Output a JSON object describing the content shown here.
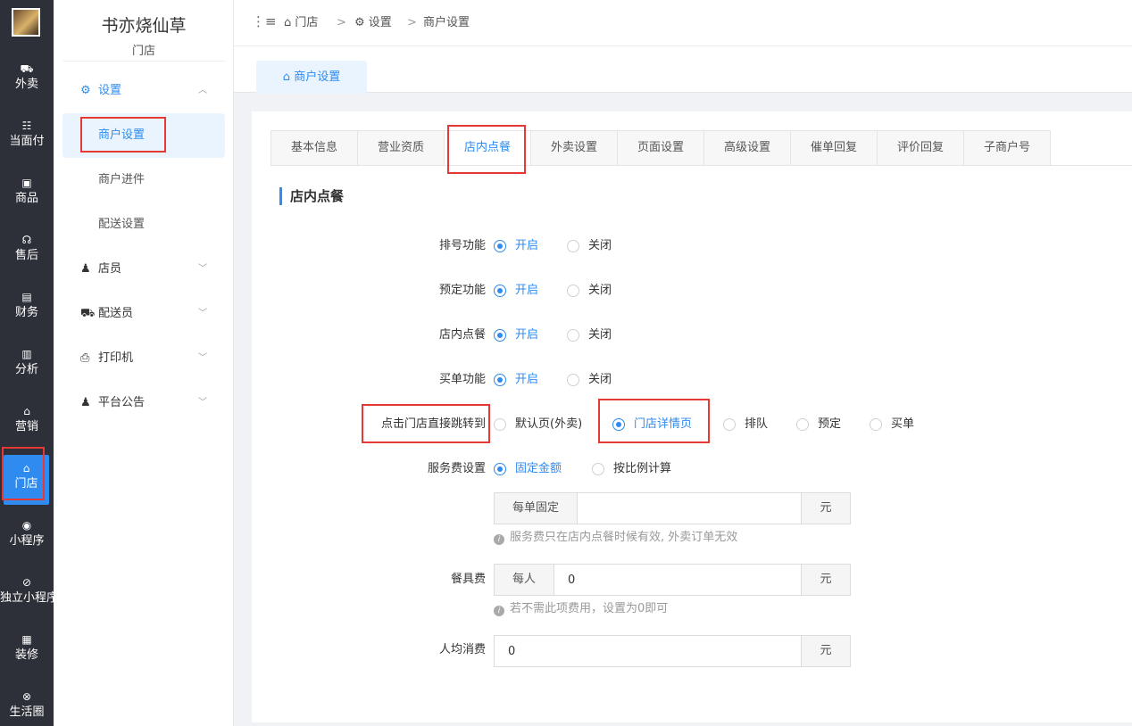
{
  "rail": {
    "items": [
      {
        "icon": "⛟",
        "label": "外卖",
        "icon_name": "scooter-icon"
      },
      {
        "icon": "☷",
        "label": "当面付",
        "icon_name": "list-icon"
      },
      {
        "icon": "▣",
        "label": "商品",
        "icon_name": "bag-icon"
      },
      {
        "icon": "☊",
        "label": "售后",
        "icon_name": "headset-icon"
      },
      {
        "icon": "▤",
        "label": "财务",
        "icon_name": "ledger-icon"
      },
      {
        "icon": "▥",
        "label": "分析",
        "icon_name": "bar-chart-icon"
      },
      {
        "icon": "⌂",
        "label": "营销",
        "icon_name": "gift-icon"
      },
      {
        "icon": "⌂",
        "label": "门店",
        "icon_name": "store-icon"
      },
      {
        "icon": "◉",
        "label": "小程序",
        "icon_name": "wechat-icon"
      },
      {
        "icon": "⊘",
        "label": "独立小程序",
        "icon_name": "mini-program-icon"
      },
      {
        "icon": "▦",
        "label": "装修",
        "icon_name": "decorate-icon"
      },
      {
        "icon": "⊗",
        "label": "生活圈",
        "icon_name": "life-circle-icon"
      }
    ]
  },
  "sidebar": {
    "title": "书亦烧仙草",
    "subtitle": "门店",
    "settings_label": "设置",
    "sub_items": [
      "商户设置",
      "商户进件",
      "配送设置"
    ],
    "menus": [
      "店员",
      "配送员",
      "打印机",
      "平台公告"
    ]
  },
  "header": {
    "crumbs": [
      "门店",
      "设置",
      "商户设置"
    ],
    "page_tab": "商户设置"
  },
  "tabs": [
    "基本信息",
    "营业资质",
    "店内点餐",
    "外卖设置",
    "页面设置",
    "高级设置",
    "催单回复",
    "评价回复",
    "子商户号"
  ],
  "section_title": "店内点餐",
  "form": {
    "toggles": [
      {
        "label": "排号功能",
        "on": "开启",
        "off": "关闭"
      },
      {
        "label": "预定功能",
        "on": "开启",
        "off": "关闭"
      },
      {
        "label": "店内点餐",
        "on": "开启",
        "off": "关闭"
      },
      {
        "label": "买单功能",
        "on": "开启",
        "off": "关闭"
      }
    ],
    "jump": {
      "label": "点击门店直接跳转到",
      "options": [
        "默认页(外卖)",
        "门店详情页",
        "排队",
        "预定",
        "买单"
      ],
      "selected": "门店详情页"
    },
    "service_fee": {
      "label": "服务费设置",
      "options": [
        "固定金额",
        "按比例计算"
      ],
      "selected": "固定金额",
      "prefix": "每单固定",
      "value": "",
      "suffix": "元",
      "hint": "服务费只在店内点餐时候有效, 外卖订单无效"
    },
    "tableware": {
      "label": "餐具费",
      "prefix": "每人",
      "value": "0",
      "suffix": "元",
      "hint": "若不需此项费用，设置为0即可"
    },
    "avg_spend": {
      "label": "人均消费",
      "value": "0",
      "suffix": "元"
    }
  }
}
